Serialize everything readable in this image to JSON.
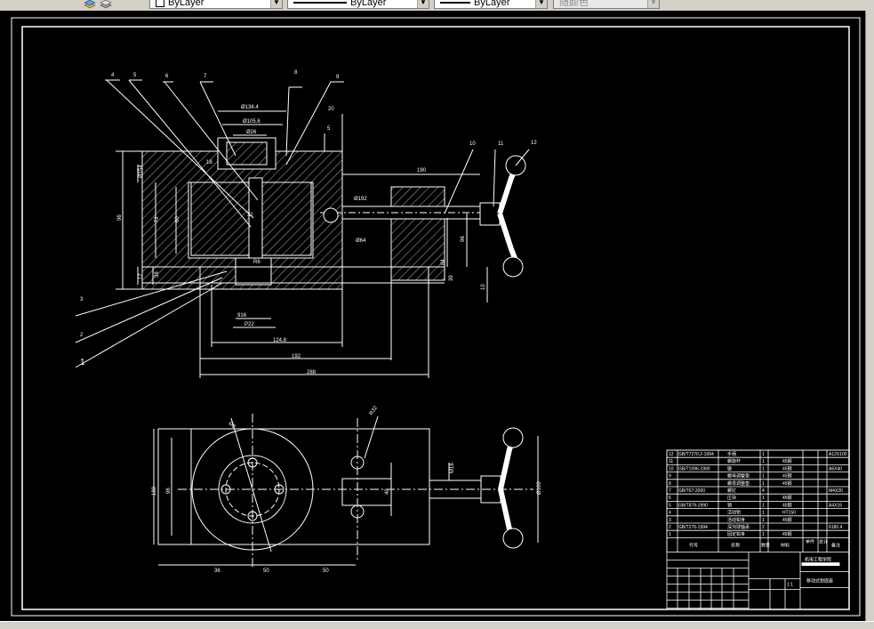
{
  "toolbar": {
    "color_combo": "ByLayer",
    "linetype_combo": "ByLayer",
    "lineweight_combo": "ByLayer",
    "plotstyle_combo": "随颜色"
  },
  "top_view": {
    "balloons": [
      "4",
      "5",
      "6",
      "7",
      "8",
      "9",
      "10",
      "11",
      "12"
    ],
    "left_balloons": [
      "3",
      "2",
      "1"
    ],
    "dims": {
      "d134": "Ø134.4",
      "d105": "Ø105.6",
      "d26": "Ø26",
      "d20": "20",
      "d5": "5",
      "d190": "190",
      "d18": "18",
      "d154": "Ø154",
      "d192": "Ø192",
      "d72": "72",
      "d60": "60",
      "d38": "38",
      "d12": "12",
      "d68": "68",
      "d96": "96",
      "d84": "84",
      "d10": "10",
      "d39": "39",
      "d50": "50",
      "d916": "916",
      "d7220": "P22",
      "d1248": "124.8",
      "d192b": "192",
      "d288": "288",
      "r6": "R6",
      "d32": "32",
      "d66": "Ø64"
    }
  },
  "bottom_view": {
    "dims": {
      "d180": "180",
      "d96": "96",
      "d36": "36",
      "d50": "50",
      "d50b": "50",
      "d100": "Ø100",
      "dm16": "M16",
      "d40": "40",
      "d8": "Ø8",
      "d32": "R32"
    }
  },
  "title_block": {
    "rows": [
      {
        "n": "12",
        "code": "GB/T7270.2-1994",
        "name": "手柄",
        "qty": "1",
        "mat": "",
        "note": "A12X100"
      },
      {
        "n": "11",
        "code": "",
        "name": "螺旋杆",
        "qty": "1",
        "mat": "45钢",
        "note": ""
      },
      {
        "n": "10",
        "code": "GB/T1096-1990",
        "name": "键",
        "qty": "1",
        "mat": "45钢",
        "note": "A6X40"
      },
      {
        "n": "9",
        "code": "",
        "name": "螺母调整垫",
        "qty": "1",
        "mat": "45钢",
        "note": ""
      },
      {
        "n": "8",
        "code": "",
        "name": "螺母调整垫",
        "qty": "1",
        "mat": "45钢",
        "note": ""
      },
      {
        "n": "7",
        "code": "GB/T67-2000",
        "name": "螺钉",
        "qty": "4",
        "mat": "",
        "note": "M4X20"
      },
      {
        "n": "6",
        "code": "",
        "name": "压块",
        "qty": "1",
        "mat": "45钢",
        "note": ""
      },
      {
        "n": "5",
        "code": "GB/T879-1990",
        "name": "销",
        "qty": "1",
        "mat": "45钢",
        "note": "A4X16"
      },
      {
        "n": "4",
        "code": "",
        "name": "活动钳",
        "qty": "1",
        "mat": "HT150",
        "note": ""
      },
      {
        "n": "3",
        "code": "",
        "name": "活动钳身",
        "qty": "1",
        "mat": "45钢",
        "note": ""
      },
      {
        "n": "2",
        "code": "GB/T276-1994",
        "name": "深沟球轴承",
        "qty": "2",
        "mat": "",
        "note": "6180.4"
      },
      {
        "n": "1",
        "code": "",
        "name": "固定钳身",
        "qty": "1",
        "mat": "45钢",
        "note": ""
      }
    ],
    "header": {
      "code": "代号",
      "name": "名称",
      "qty": "数量",
      "mat": "材料",
      "unit": "单件",
      "total": "总计",
      "note": "备注"
    },
    "company": "机电工程学院",
    "drawing_title": "移动式钳底座",
    "scale_label": "1:1"
  }
}
